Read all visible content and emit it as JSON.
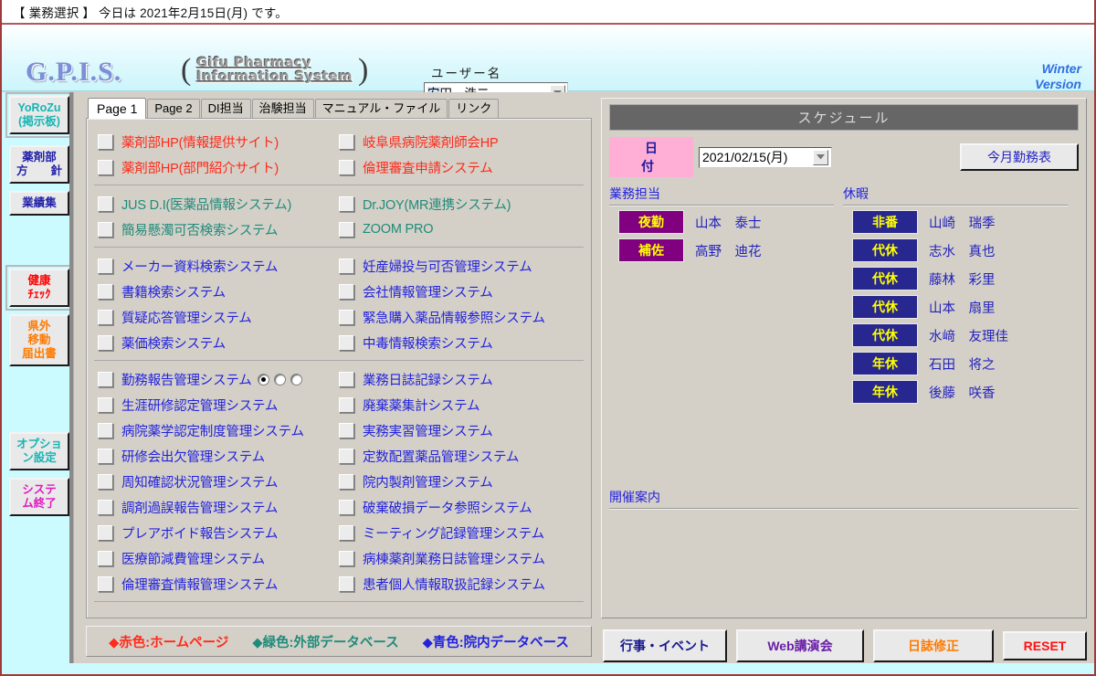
{
  "titlebar": {
    "text": "【 業務選択 】 今日は 2021年2月15日(月) です。"
  },
  "header": {
    "logo": "G.P.I.S.",
    "logo_sub_line1": "Gifu Pharmacy",
    "logo_sub_line2": "Information System",
    "paren_open": "(",
    "paren_close": ")",
    "user_label": "ユーザー名",
    "user_value_selected": "安",
    "user_value_rest": "田　浩二",
    "version_line1": "Winter",
    "version_line2": "Version"
  },
  "rail": {
    "items": [
      {
        "name": "yorozu",
        "lines": [
          "YoRoZu",
          "(掲示板)"
        ],
        "color": "c-teal",
        "focus": true
      },
      {
        "name": "pharmacy-policy",
        "lines": [
          "薬剤部",
          "方　　針"
        ],
        "color": "c-blue",
        "focus": false
      },
      {
        "name": "achievements",
        "lines": [
          "業績集"
        ],
        "color": "c-blue",
        "focus": false
      },
      {
        "name": "health-check",
        "lines": [
          "健康",
          "ﾁｪｯｸ"
        ],
        "color": "c-red",
        "focus": true
      },
      {
        "name": "travel-report",
        "lines": [
          "県外",
          "移動",
          "届出書"
        ],
        "color": "c-orange",
        "focus": false
      },
      {
        "name": "option-settings",
        "lines": [
          "オプショ",
          "ン設定"
        ],
        "color": "c-teal",
        "focus": false
      },
      {
        "name": "system-exit",
        "lines": [
          "システ",
          "ム終了"
        ],
        "color": "c-magenta",
        "focus": false
      }
    ]
  },
  "tabs": [
    {
      "label": "Page 1",
      "active": true
    },
    {
      "label": "Page 2",
      "active": false
    },
    {
      "label": "DI担当",
      "active": false
    },
    {
      "label": "治験担当",
      "active": false
    },
    {
      "label": "マニュアル・ファイル",
      "active": false
    },
    {
      "label": "リンク",
      "active": false
    }
  ],
  "groups": [
    {
      "rows": [
        [
          {
            "label": "薬剤部HP(情報提供サイト)",
            "color": "red"
          },
          {
            "label": "岐阜県病院薬剤師会HP",
            "color": "red"
          }
        ],
        [
          {
            "label": "薬剤部HP(部門紹介サイト)",
            "color": "red"
          },
          {
            "label": "倫理審査申請システム",
            "color": "red"
          }
        ]
      ]
    },
    {
      "rows": [
        [
          {
            "label": "JUS D.I(医薬品情報システム)",
            "color": "green"
          },
          {
            "label": "Dr.JOY(MR連携システム)",
            "color": "green"
          }
        ],
        [
          {
            "label": "簡易懸濁可否検索システム",
            "color": "green"
          },
          {
            "label": "ZOOM PRO",
            "color": "green"
          }
        ]
      ]
    },
    {
      "rows": [
        [
          {
            "label": "メーカー資料検索システム",
            "color": "blue"
          },
          {
            "label": "妊産婦投与可否管理システム",
            "color": "blue"
          }
        ],
        [
          {
            "label": "書籍検索システム",
            "color": "blue"
          },
          {
            "label": "会社情報管理システム",
            "color": "blue"
          }
        ],
        [
          {
            "label": "質疑応答管理システム",
            "color": "blue"
          },
          {
            "label": "緊急購入薬品情報参照システム",
            "color": "blue"
          }
        ],
        [
          {
            "label": "薬価検索システム",
            "color": "blue"
          },
          {
            "label": "中毒情報検索システム",
            "color": "blue"
          }
        ]
      ]
    },
    {
      "rows": [
        [
          {
            "label": "勤務報告管理システム",
            "color": "blue",
            "radios": [
              true,
              false,
              false
            ]
          },
          {
            "label": "業務日誌記録システム",
            "color": "blue"
          }
        ],
        [
          {
            "label": "生涯研修認定管理システム",
            "color": "blue"
          },
          {
            "label": "廃棄薬集計システム",
            "color": "blue"
          }
        ],
        [
          {
            "label": "病院薬学認定制度管理システム",
            "color": "blue"
          },
          {
            "label": "実務実習管理システム",
            "color": "blue"
          }
        ],
        [
          {
            "label": "研修会出欠管理システム",
            "color": "blue"
          },
          {
            "label": "定数配置薬品管理システム",
            "color": "blue"
          }
        ],
        [
          {
            "label": "周知確認状況管理システム",
            "color": "blue"
          },
          {
            "label": "院内製剤管理システム",
            "color": "blue"
          }
        ],
        [
          {
            "label": "調剤過誤報告管理システム",
            "color": "blue"
          },
          {
            "label": "破棄破損データ参照システム",
            "color": "blue"
          }
        ],
        [
          {
            "label": "プレアボイド報告システム",
            "color": "blue"
          },
          {
            "label": "ミーティング記録管理システム",
            "color": "blue"
          }
        ],
        [
          {
            "label": "医療節減費管理システム",
            "color": "blue"
          },
          {
            "label": "病棟薬剤業務日誌管理システム",
            "color": "blue"
          }
        ],
        [
          {
            "label": "倫理審査情報管理システム",
            "color": "blue"
          },
          {
            "label": "患者個人情報取扱記録システム",
            "color": "blue"
          }
        ]
      ]
    }
  ],
  "schedule": {
    "title": "スケジュール",
    "date_label": "日　付",
    "date_value": "2021/02/15(月)",
    "month_button": "今月勤務表",
    "duty_header": "業務担当",
    "leave_header": "休暇",
    "duty": [
      {
        "badge": "夜勤",
        "name": "山本　泰士"
      },
      {
        "badge": "補佐",
        "name": "高野　迪花"
      }
    ],
    "leave": [
      {
        "badge": "非番",
        "name": "山崎　瑞季"
      },
      {
        "badge": "代休",
        "name": "志水　真也"
      },
      {
        "badge": "代休",
        "name": "藤林　彩里"
      },
      {
        "badge": "代休",
        "name": "山本　扇里"
      },
      {
        "badge": "代休",
        "name": "水﨑　友理佳"
      },
      {
        "badge": "年休",
        "name": "石田　将之"
      },
      {
        "badge": "年休",
        "name": "後藤　咲香"
      }
    ],
    "event_header": "開催案内"
  },
  "legend": [
    {
      "text": "◆赤色:ホームページ",
      "color": "#ff2a1a"
    },
    {
      "text": "◆緑色:外部データベース",
      "color": "#1f8b7a"
    },
    {
      "text": "◆青色:院内データベース",
      "color": "#2222dd"
    }
  ],
  "bottom_buttons": [
    {
      "label": "行事・イベント",
      "color": "t-navy",
      "w": "w1"
    },
    {
      "label": "Web講演会",
      "color": "t-purple",
      "w": "w2"
    },
    {
      "label": "日誌修正",
      "color": "t-orange",
      "w": "w3"
    },
    {
      "label": "RESET",
      "color": "t-red",
      "w": "w4"
    }
  ],
  "colors": {
    "accent_cyan": "#ccfbff",
    "border_red": "#a03a3a",
    "panel_gray": "#d4d0c8",
    "duty_badge": "#800080",
    "leave_badge": "#27278f",
    "badge_text": "#ffff00",
    "date_label_bg": "#ffaed6"
  }
}
